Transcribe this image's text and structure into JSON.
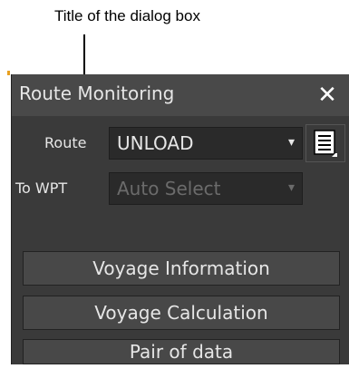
{
  "annotation": {
    "text": "Title of the dialog box"
  },
  "dialog": {
    "title": "Route Monitoring",
    "close_label": "✕",
    "route": {
      "label": "Route",
      "value": "UNLOAD",
      "arrow": "▾"
    },
    "to_wpt": {
      "label": "To WPT",
      "value": "Auto Select",
      "arrow": "▾"
    },
    "buttons": [
      {
        "label": "Voyage Information"
      },
      {
        "label": "Voyage Calculation"
      },
      {
        "label": "Pair of data"
      }
    ]
  },
  "icons": {
    "close": "close-icon",
    "list": "list-icon",
    "dropdown": "chevron-down-icon"
  },
  "colors": {
    "dialog_bg": "#3a3a3a",
    "titlebar_bg": "#494949",
    "text": "#e6e6e6",
    "disabled_text": "#6b6b6b",
    "button_bg": "#484848"
  }
}
